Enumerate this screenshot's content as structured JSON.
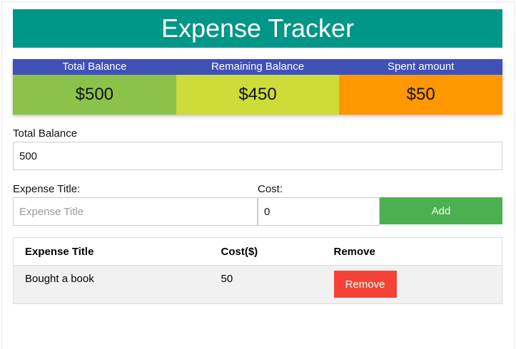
{
  "header": {
    "title": "Expense Tracker"
  },
  "summary": {
    "total": {
      "label": "Total Balance",
      "value": "$500"
    },
    "remaining": {
      "label": "Remaining Balance",
      "value": "$450"
    },
    "spent": {
      "label": "Spent amount",
      "value": "$50"
    }
  },
  "form": {
    "total_balance_label": "Total Balance",
    "total_balance_value": "500",
    "expense_title_label": "Expense Title:",
    "expense_title_placeholder": "Expense Title",
    "expense_title_value": "",
    "cost_label": "Cost:",
    "cost_value": "0",
    "add_label": "Add"
  },
  "table": {
    "headers": [
      "Expense Title",
      "Cost($)",
      "Remove"
    ],
    "rows": [
      {
        "title": "Bought a book",
        "cost": "50",
        "action_label": "Remove"
      }
    ]
  },
  "colors": {
    "header": "#009688",
    "card_head": "#3f51b5",
    "total": "#8bc34a",
    "remaining": "#cddc39",
    "spent": "#ff9800",
    "add_button": "#4caf50",
    "remove_button": "#f44336"
  }
}
